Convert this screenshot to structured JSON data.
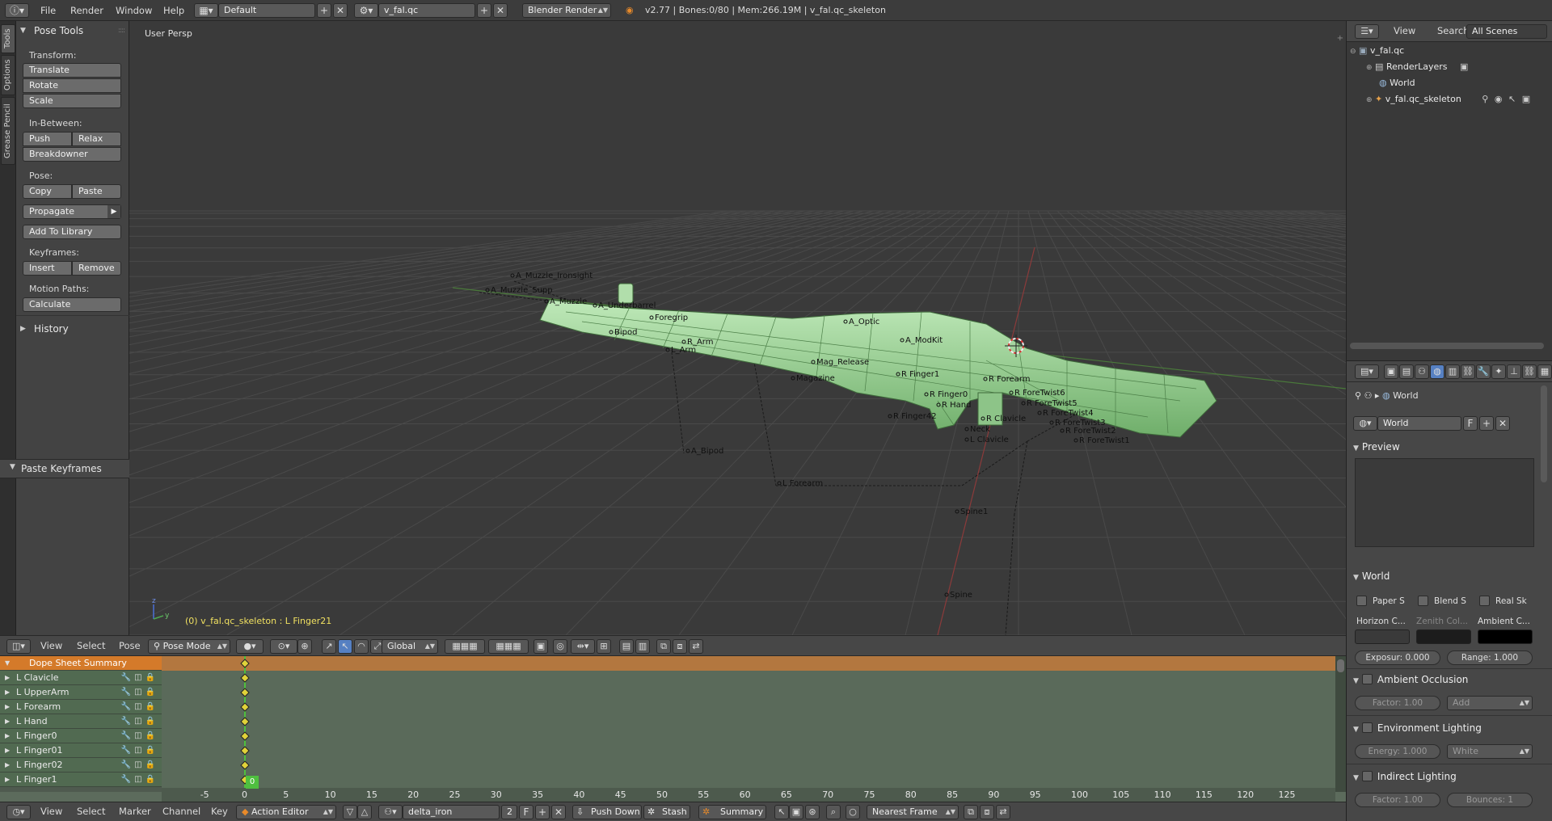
{
  "topbar": {
    "menus": [
      "File",
      "Render",
      "Window",
      "Help"
    ],
    "screen_layout": "Default",
    "scene": "v_fal.qc",
    "render_engine": "Blender Render",
    "stats": "v2.77 | Bones:0/80  | Mem:266.19M | v_fal.qc_skeleton"
  },
  "left_tabs": [
    "Tools",
    "Options",
    "Grease Pencil"
  ],
  "tool_shelf": {
    "panel_title": "Pose Tools",
    "transform_label": "Transform:",
    "translate": "Translate",
    "rotate": "Rotate",
    "scale": "Scale",
    "inbetween_label": "In-Between:",
    "push": "Push",
    "relax": "Relax",
    "breakdowner": "Breakdowner",
    "pose_label": "Pose:",
    "copy": "Copy",
    "paste": "Paste",
    "propagate": "Propagate",
    "add_to_library": "Add To Library",
    "keyframes_label": "Keyframes:",
    "insert": "Insert",
    "remove": "Remove",
    "motion_paths_label": "Motion Paths:",
    "calculate": "Calculate",
    "history": "History",
    "paste_keyframes": "Paste Keyframes"
  },
  "viewport": {
    "view_name": "User Persp",
    "status_text": "(0) v_fal.qc_skeleton : L Finger21",
    "bone_labels": [
      "A_Muzzle_Ironsight",
      "A_Muzzle_Supp",
      "A_Muzzle",
      "A_Underbarrel",
      "Foregrip",
      "Bipod",
      "R_Arm",
      "L_Arm",
      "A_Bipod",
      "A_Optic",
      "A_ModKit",
      "Mag_Release",
      "Magazine",
      "R Forearm",
      "R ForeTwist6",
      "R ForeTwist5",
      "R ForeTwist4",
      "R ForeTwist3",
      "R ForeTwist2",
      "R ForeTwist1",
      "R Clavicle",
      "Neck",
      "L Clavicle",
      "Spine1",
      "Spine",
      "R Finger1",
      "R Finger0",
      "R Hand",
      "R Finger42",
      "L Forearm"
    ]
  },
  "viewport_header": {
    "menus": [
      "View",
      "Select",
      "Pose"
    ],
    "mode": "Pose Mode",
    "orientation": "Global"
  },
  "dopesheet": {
    "summary": "Dope Sheet Summary",
    "channels": [
      "L Clavicle",
      "L UpperArm",
      "L Forearm",
      "L Hand",
      "L Finger0",
      "L Finger01",
      "L Finger02",
      "L Finger1"
    ],
    "current_frame": "0",
    "ruler_ticks": [
      "-5",
      "0",
      "5",
      "10",
      "15",
      "20",
      "25",
      "30",
      "35",
      "40",
      "45",
      "50",
      "55",
      "60",
      "65",
      "70",
      "75",
      "80",
      "85",
      "90",
      "95",
      "100",
      "105",
      "110",
      "115",
      "120",
      "125"
    ]
  },
  "bottom_header": {
    "menus": [
      "View",
      "Select",
      "Marker",
      "Channel",
      "Key"
    ],
    "editor_mode": "Action Editor",
    "action_name": "delta_iron",
    "users": "2",
    "fake_user": "F",
    "push_down": "Push Down",
    "stash": "Stash",
    "summary": "Summary",
    "snap": "Nearest Frame"
  },
  "outliner": {
    "menus": [
      "View",
      "Search"
    ],
    "display": "All Scenes",
    "items": [
      "v_fal.qc",
      "RenderLayers",
      "World",
      "v_fal.qc_skeleton"
    ]
  },
  "properties": {
    "breadcrumb": "World",
    "world_name": "World",
    "fake_user": "F",
    "preview": "Preview",
    "world_section": "World",
    "paper_sky": "Paper S",
    "blend_sky": "Blend S",
    "real_sky": "Real Sk",
    "horizon_color": "Horizon C...",
    "zenith_color": "Zenith Col...",
    "ambient_color": "Ambient C...",
    "exposure": "Exposur: 0.000",
    "range": "Range:   1.000",
    "ambient_occlusion": "Ambient Occlusion",
    "ao_factor": "Factor:      1.00",
    "ao_blend": "Add",
    "environment_lighting": "Environment Lighting",
    "env_energy": "Energy:  1.000",
    "env_color": "White",
    "indirect_lighting": "Indirect Lighting",
    "ind_factor": "Factor:      1.00",
    "ind_bounces": "Bounces:    1"
  },
  "colors": {
    "accent_blue": "#5680c2",
    "summary_orange": "#d47a2a",
    "keyframe_yellow": "#e0d23a",
    "current_frame_green": "#4fbf3f",
    "mesh_green": "#9ed69a"
  }
}
